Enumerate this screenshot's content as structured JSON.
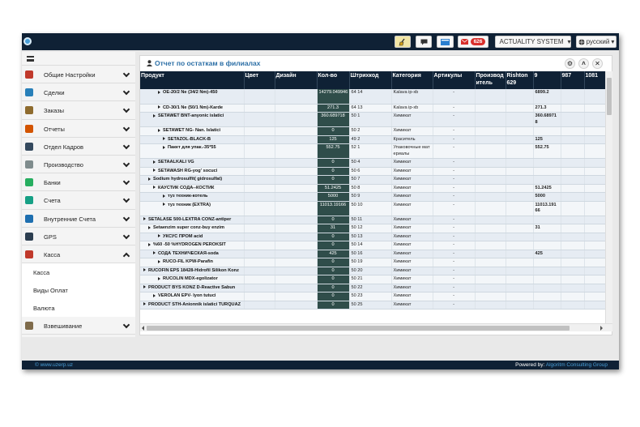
{
  "topbar": {
    "user_label": "ACTUALITY SYSTEM",
    "language_label": "русский",
    "mail_count": "626",
    "colors": {
      "bar": "#0f2135",
      "badge": "#d9302c",
      "accent": "#4a9fd8"
    }
  },
  "sidebar": {
    "items": [
      {
        "label": "Общие Настройки",
        "icon": "settings-icon"
      },
      {
        "label": "Сделки",
        "icon": "deals-icon"
      },
      {
        "label": "Заказы",
        "icon": "orders-icon"
      },
      {
        "label": "Отчеты",
        "icon": "reports-icon"
      },
      {
        "label": "Отдел Кадров",
        "icon": "staff-icon"
      },
      {
        "label": "Производство",
        "icon": "production-icon"
      },
      {
        "label": "Банки",
        "icon": "bank-icon"
      },
      {
        "label": "Счета",
        "icon": "accounts-icon"
      },
      {
        "label": "Внутренние Счета",
        "icon": "internal-accounts-icon"
      },
      {
        "label": "GPS",
        "icon": "gps-icon"
      },
      {
        "label": "Касса",
        "icon": "cash-icon",
        "expanded": true
      },
      {
        "label": "Взвешивание",
        "icon": "weighing-icon"
      }
    ],
    "subitems": [
      "Касса",
      "Виды Оплат",
      "Валюта"
    ]
  },
  "panel": {
    "title": "Отчет по остаткам в филиалах"
  },
  "table": {
    "columns": [
      "Продукт",
      "Цвет",
      "Дизайн",
      "Кол-во",
      "Штрихкод",
      "Категория",
      "Артикулы",
      "Производ итель",
      "Rishton 629",
      "9",
      "987",
      "1081"
    ],
    "rows": [
      {
        "indent": 3,
        "product": "OE-20/2 Ne (34/2 Nm)-450",
        "qty": "14279.049946",
        "barcode": "64 14",
        "category": "Kalava ip-xb",
        "article": "-",
        "val": "6899.2",
        "tall": true
      },
      {
        "indent": 3,
        "product": "CD-30/1 Ne (50/1 Nm)-Karde",
        "qty": "271.3",
        "barcode": "64 13",
        "category": "Kalava ip-xb",
        "article": "-",
        "val": "271.3"
      },
      {
        "indent": 2,
        "product": "SETAWET BNT-anyonic islatici",
        "qty": "360.689718",
        "barcode": "50 1",
        "category": "Химикат",
        "article": "-",
        "val": "360.689718",
        "tall": true
      },
      {
        "indent": 3,
        "product": "SETAWET NG- Nan. Islatici",
        "qty": "0",
        "barcode": "50 2",
        "category": "Химикат",
        "article": "-",
        "val": ""
      },
      {
        "indent": 4,
        "product": "SETAZOL-BLACK-B",
        "qty": "125",
        "barcode": "49 2",
        "category": "Краситель",
        "article": "-",
        "val": "125"
      },
      {
        "indent": 4,
        "product": "Пакет для упак.-35*55",
        "qty": "552.75",
        "barcode": "52 1",
        "category": "Упаковочные материалы",
        "article": "-",
        "val": "552.75",
        "tall": true
      },
      {
        "indent": 2,
        "product": "SETAALKALI VG",
        "qty": "0",
        "barcode": "50 4",
        "category": "Химикат",
        "article": "-",
        "val": ""
      },
      {
        "indent": 2,
        "product": "SETAWASH RG-yog' socuci",
        "qty": "0",
        "barcode": "50 6",
        "category": "Химикат",
        "article": "-",
        "val": ""
      },
      {
        "indent": 1,
        "product": "Sodium hydrosulfit( gidrosulfat)",
        "qty": "0",
        "barcode": "50 7",
        "category": "Химикат",
        "article": "-",
        "val": ""
      },
      {
        "indent": 2,
        "product": "КАУСТИК СОДА--КОСТИК",
        "qty": "51.2425",
        "barcode": "50 8",
        "category": "Химикат",
        "article": "-",
        "val": "51.2425"
      },
      {
        "indent": 4,
        "product": "туз техник-котель",
        "qty": "5000",
        "barcode": "50 9",
        "category": "Химикат",
        "article": "-",
        "val": "5000"
      },
      {
        "indent": 4,
        "product": "туз техник (EXTRA)",
        "qty": "11013.19166",
        "barcode": "50 10",
        "category": "Химикат",
        "article": "-",
        "val": "11013.19166",
        "tall": true
      },
      {
        "indent": 0,
        "product": "SETALASE 500-LEXTRA CONZ-antiper",
        "qty": "0",
        "barcode": "50 11",
        "category": "Химикат",
        "article": "-",
        "val": ""
      },
      {
        "indent": 1,
        "product": "Setaenzim super conz-buy enzim",
        "qty": "31",
        "barcode": "50 12",
        "category": "Химикат",
        "article": "-",
        "val": "31"
      },
      {
        "indent": 3,
        "product": "УКСУС ПРОМ acid",
        "qty": "0",
        "barcode": "50 13",
        "category": "Химикат",
        "article": "-",
        "val": ""
      },
      {
        "indent": 1,
        "product": "%60 -50 %HYDROGEN PEROKSIT",
        "qty": "0",
        "barcode": "50 14",
        "category": "Химикат",
        "article": "-",
        "val": ""
      },
      {
        "indent": 2,
        "product": "СОДА ТЕХНИЧЕСКАЯ-soda",
        "qty": "425",
        "barcode": "50 16",
        "category": "Химикат",
        "article": "-",
        "val": "425"
      },
      {
        "indent": 3,
        "product": "RUCO-FIL KPW-Parafin",
        "qty": "0",
        "barcode": "50 19",
        "category": "Химикат",
        "article": "-",
        "val": ""
      },
      {
        "indent": 0,
        "product": "RUCOFIN EPS 18428-Hidrofil Silikon Konz",
        "qty": "0",
        "barcode": "50 20",
        "category": "Химикат",
        "article": "-",
        "val": ""
      },
      {
        "indent": 3,
        "product": "RUCOLIN MDX-egolizator",
        "qty": "0",
        "barcode": "50 21",
        "category": "Химикат",
        "article": "-",
        "val": ""
      },
      {
        "indent": 0,
        "product": "PRODUCT BYS KONZ D-Reactive Sabun",
        "qty": "0",
        "barcode": "50 22",
        "category": "Химикат",
        "article": "-",
        "val": ""
      },
      {
        "indent": 2,
        "product": "VEROLAN EPV- lyon tutuci",
        "qty": "0",
        "barcode": "50 23",
        "category": "Химикат",
        "article": "-",
        "val": ""
      },
      {
        "indent": 0,
        "product": "PRODUCT STH-Anionnik islatici TURQUAZ",
        "qty": "0",
        "barcode": "50 25",
        "category": "Химикат",
        "article": "-",
        "val": ""
      }
    ]
  },
  "footer": {
    "left": "© www.uzerp.uz",
    "powered_prefix": "Powered by:",
    "powered_company": "Algoritm Consulting Group"
  }
}
